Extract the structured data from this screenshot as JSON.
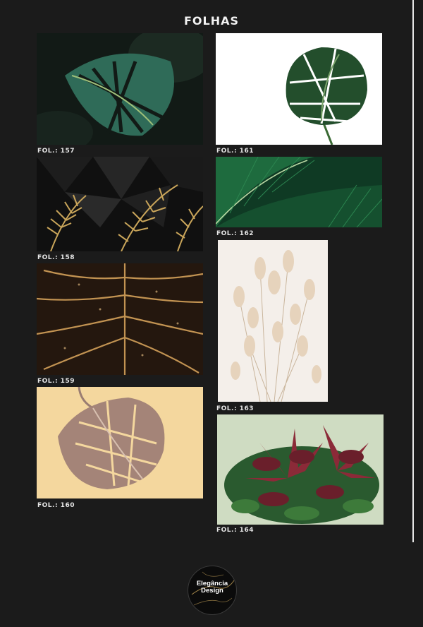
{
  "page": {
    "title": "FOLHAS"
  },
  "colors": {
    "background": "#1b1b1b",
    "caption": "#e6e6e6",
    "gold": "#c9a55a"
  },
  "items": [
    {
      "code": "FOL.: 157",
      "subject": "monstera leaf on dark background"
    },
    {
      "code": "FOL.: 158",
      "subject": "golden palm leaves on dark geometric background"
    },
    {
      "code": "FOL.: 159",
      "subject": "dark leaf with gold veins"
    },
    {
      "code": "FOL.: 160",
      "subject": "rose gold monstera leaf on cream background"
    },
    {
      "code": "FOL.: 161",
      "subject": "monstera leaf on white background"
    },
    {
      "code": "FOL.: 162",
      "subject": "green banana leaves"
    },
    {
      "code": "FOL.: 163",
      "subject": "beige pampas bunny tails"
    },
    {
      "code": "FOL.: 164",
      "subject": "red and green plant"
    }
  ],
  "logo": {
    "line1": "Elegância",
    "line2": "Design"
  }
}
